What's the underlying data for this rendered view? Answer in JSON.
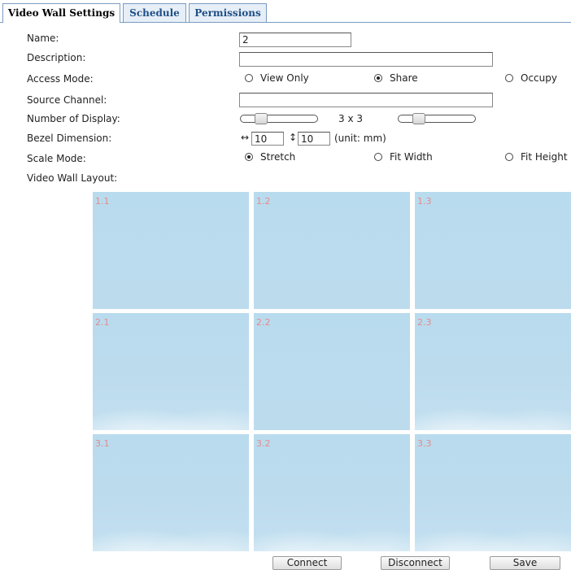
{
  "tabs": [
    {
      "label": "Video Wall Settings",
      "active": true
    },
    {
      "label": "Schedule",
      "active": false
    },
    {
      "label": "Permissions",
      "active": false
    }
  ],
  "form": {
    "name_label": "Name:",
    "name_value": "2",
    "description_label": "Description:",
    "description_value": "",
    "access_mode_label": "Access Mode:",
    "access_modes": [
      {
        "label": "View Only",
        "checked": false
      },
      {
        "label": "Share",
        "checked": true
      },
      {
        "label": "Occupy",
        "checked": false
      }
    ],
    "source_channel_label": "Source Channel:",
    "source_channel_value": "",
    "number_of_display_label": "Number of Display:",
    "display_cols": "3",
    "display_x": "x",
    "display_rows": "3",
    "bezel_label": "Bezel Dimension:",
    "bezel_h_icon": "horizontal-arrows-icon",
    "bezel_h_value": "10",
    "bezel_v_icon": "vertical-arrows-icon",
    "bezel_v_value": "10",
    "bezel_unit": "(unit: mm)",
    "scale_mode_label": "Scale Mode:",
    "scale_modes": [
      {
        "label": "Stretch",
        "checked": true
      },
      {
        "label": "Fit Width",
        "checked": false
      },
      {
        "label": "Fit Height",
        "checked": false
      }
    ],
    "layout_label": "Video Wall Layout:"
  },
  "layout_cells": [
    "1.1",
    "1.2",
    "1.3",
    "2.1",
    "2.2",
    "2.3",
    "3.1",
    "3.2",
    "3.3"
  ],
  "buttons": {
    "connect": "Connect",
    "disconnect": "Disconnect",
    "save": "Save"
  }
}
